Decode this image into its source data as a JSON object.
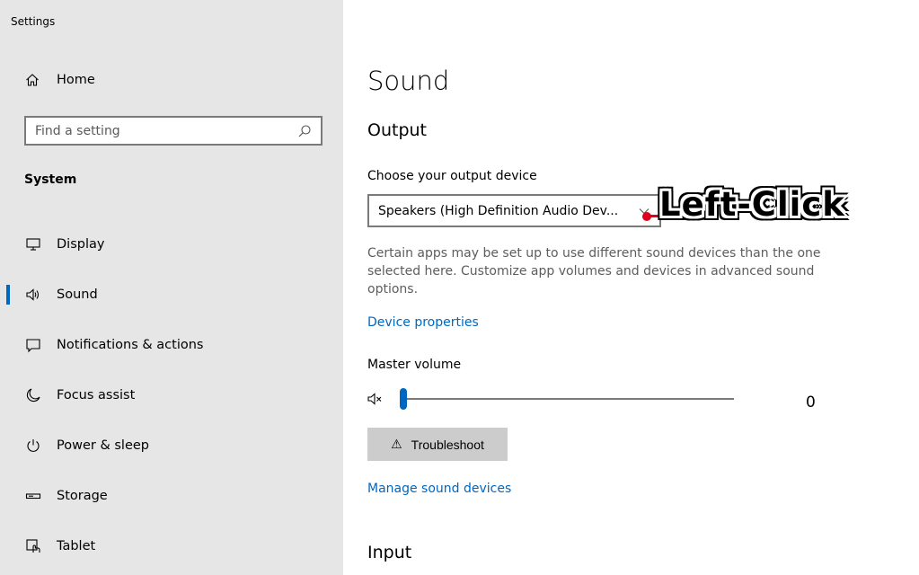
{
  "window": {
    "title": "Settings"
  },
  "sidebar": {
    "home_label": "Home",
    "search": {
      "placeholder": "Find a setting"
    },
    "section_title": "System",
    "items": [
      {
        "label": "Display",
        "icon": "display-icon"
      },
      {
        "label": "Sound",
        "icon": "speaker-icon",
        "active": true
      },
      {
        "label": "Notifications & actions",
        "icon": "notification-icon"
      },
      {
        "label": "Focus assist",
        "icon": "moon-icon"
      },
      {
        "label": "Power & sleep",
        "icon": "power-icon"
      },
      {
        "label": "Storage",
        "icon": "storage-icon"
      },
      {
        "label": "Tablet",
        "icon": "tablet-icon"
      }
    ]
  },
  "main": {
    "title": "Sound",
    "output": {
      "heading": "Output",
      "device_label": "Choose your output device",
      "device_value": "Speakers (High Definition Audio Dev...",
      "help_text": "Certain apps may be set up to use different sound devices than the one selected here. Customize app volumes and devices in advanced sound options.",
      "device_properties_link": "Device properties",
      "master_volume_label": "Master volume",
      "volume_value": "0",
      "troubleshoot_label": "Troubleshoot",
      "manage_link": "Manage sound devices"
    },
    "input": {
      "heading": "Input"
    }
  },
  "annotation": {
    "label": "Left-Click"
  },
  "colors": {
    "accent": "#0067c0",
    "sidebar_bg": "#e6e6e6",
    "annotation_red": "#e0001b"
  }
}
